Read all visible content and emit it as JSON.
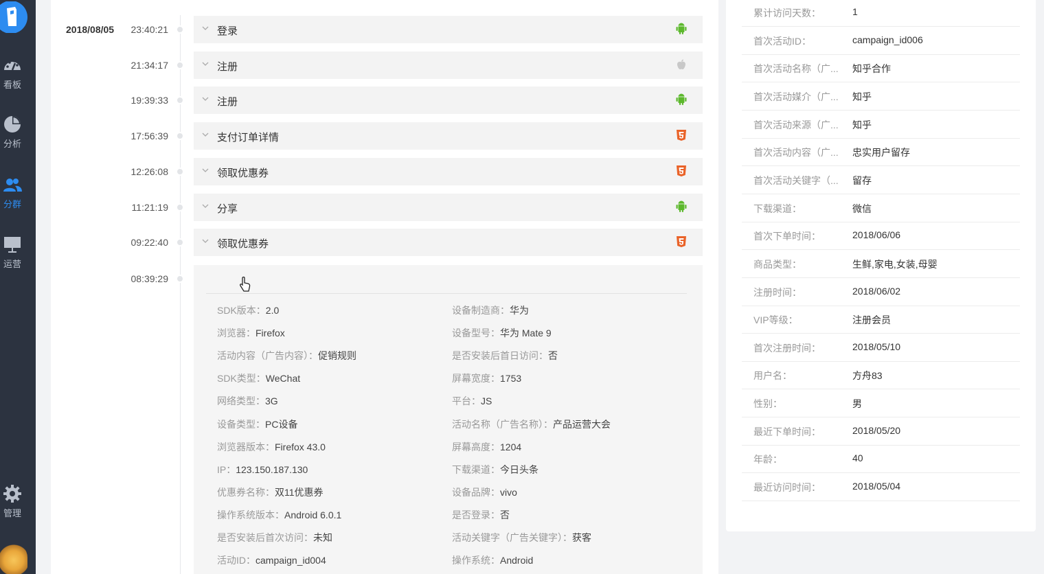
{
  "nav": {
    "items": [
      {
        "label": "看板",
        "icon": "dashboard-icon"
      },
      {
        "label": "分析",
        "icon": "pie-chart-icon"
      },
      {
        "label": "分群",
        "icon": "users-icon"
      },
      {
        "label": "运营",
        "icon": "presentation-icon"
      },
      {
        "label": "管理",
        "icon": "gear-icon"
      }
    ],
    "active": "分群"
  },
  "timeline": {
    "date": "2018/08/05",
    "events": [
      {
        "time": "23:40:21",
        "name": "登录",
        "platform": "android"
      },
      {
        "time": "21:34:17",
        "name": "注册",
        "platform": "apple"
      },
      {
        "time": "19:39:33",
        "name": "注册",
        "platform": "android"
      },
      {
        "time": "17:56:39",
        "name": "支付订单详情",
        "platform": "html5"
      },
      {
        "time": "12:26:08",
        "name": "领取优惠券",
        "platform": "html5"
      },
      {
        "time": "11:21:19",
        "name": "分享",
        "platform": "android"
      },
      {
        "time": "09:22:40",
        "name": "领取优惠券",
        "platform": "html5"
      },
      {
        "time": "08:39:29",
        "name": "领取优惠券",
        "platform": "html5"
      }
    ],
    "expanded": {
      "left": [
        {
          "k": "SDK版本：",
          "v": "2.0"
        },
        {
          "k": "浏览器：",
          "v": "Firefox"
        },
        {
          "k": "活动内容（广告内容）：",
          "v": "促销规则"
        },
        {
          "k": "SDK类型：",
          "v": "WeChat"
        },
        {
          "k": "网络类型：",
          "v": "3G"
        },
        {
          "k": "设备类型：",
          "v": "PC设备"
        },
        {
          "k": "浏览器版本：",
          "v": "Firefox 43.0"
        },
        {
          "k": "IP：",
          "v": "123.150.187.130"
        },
        {
          "k": "优惠券名称：",
          "v": "双11优惠券"
        },
        {
          "k": "操作系统版本：",
          "v": "Android 6.0.1"
        },
        {
          "k": "是否安装后首次访问：",
          "v": "未知"
        },
        {
          "k": "活动ID：",
          "v": "campaign_id004"
        }
      ],
      "right": [
        {
          "k": "设备制造商：",
          "v": "华为"
        },
        {
          "k": "设备型号：",
          "v": "华为 Mate 9"
        },
        {
          "k": "是否安装后首日访问：",
          "v": "否"
        },
        {
          "k": "屏幕宽度：",
          "v": "1753"
        },
        {
          "k": "平台：",
          "v": "JS"
        },
        {
          "k": "活动名称（广告名称）：",
          "v": "产品运营大会"
        },
        {
          "k": "屏幕高度：",
          "v": "1204"
        },
        {
          "k": "下载渠道：",
          "v": "今日头条"
        },
        {
          "k": "设备品牌：",
          "v": "vivo"
        },
        {
          "k": "是否登录：",
          "v": "否"
        },
        {
          "k": "活动关键字（广告关键字）：",
          "v": "获客"
        },
        {
          "k": "操作系统：",
          "v": "Android"
        }
      ]
    }
  },
  "profile": [
    {
      "k": "累计访问天数：",
      "v": "1"
    },
    {
      "k": "首次活动ID：",
      "v": "campaign_id006"
    },
    {
      "k": "首次活动名称（广...",
      "v": "知乎合作"
    },
    {
      "k": "首次活动媒介（广...",
      "v": "知乎"
    },
    {
      "k": "首次活动来源（广...",
      "v": "知乎"
    },
    {
      "k": "首次活动内容（广...",
      "v": "忠实用户留存"
    },
    {
      "k": "首次活动关键字（...",
      "v": "留存"
    },
    {
      "k": "下载渠道：",
      "v": "微信"
    },
    {
      "k": "首次下单时间：",
      "v": "2018/06/06"
    },
    {
      "k": "商品类型：",
      "v": "生鲜,家电,女装,母婴"
    },
    {
      "k": "注册时间：",
      "v": "2018/06/02"
    },
    {
      "k": "VIP等级：",
      "v": "注册会员"
    },
    {
      "k": "首次注册时间：",
      "v": "2018/05/10"
    },
    {
      "k": "用户名：",
      "v": "方舟83"
    },
    {
      "k": "性别：",
      "v": "男"
    },
    {
      "k": "最近下单时间：",
      "v": "2018/05/20"
    },
    {
      "k": "年龄：",
      "v": "40"
    },
    {
      "k": "最近访问时间：",
      "v": "2018/05/04"
    }
  ],
  "colors": {
    "sidebar": "#2c3340",
    "active": "#2d8cf0",
    "android": "#5cb82c",
    "apple": "#c8c8c8",
    "html5": "#e96228"
  }
}
